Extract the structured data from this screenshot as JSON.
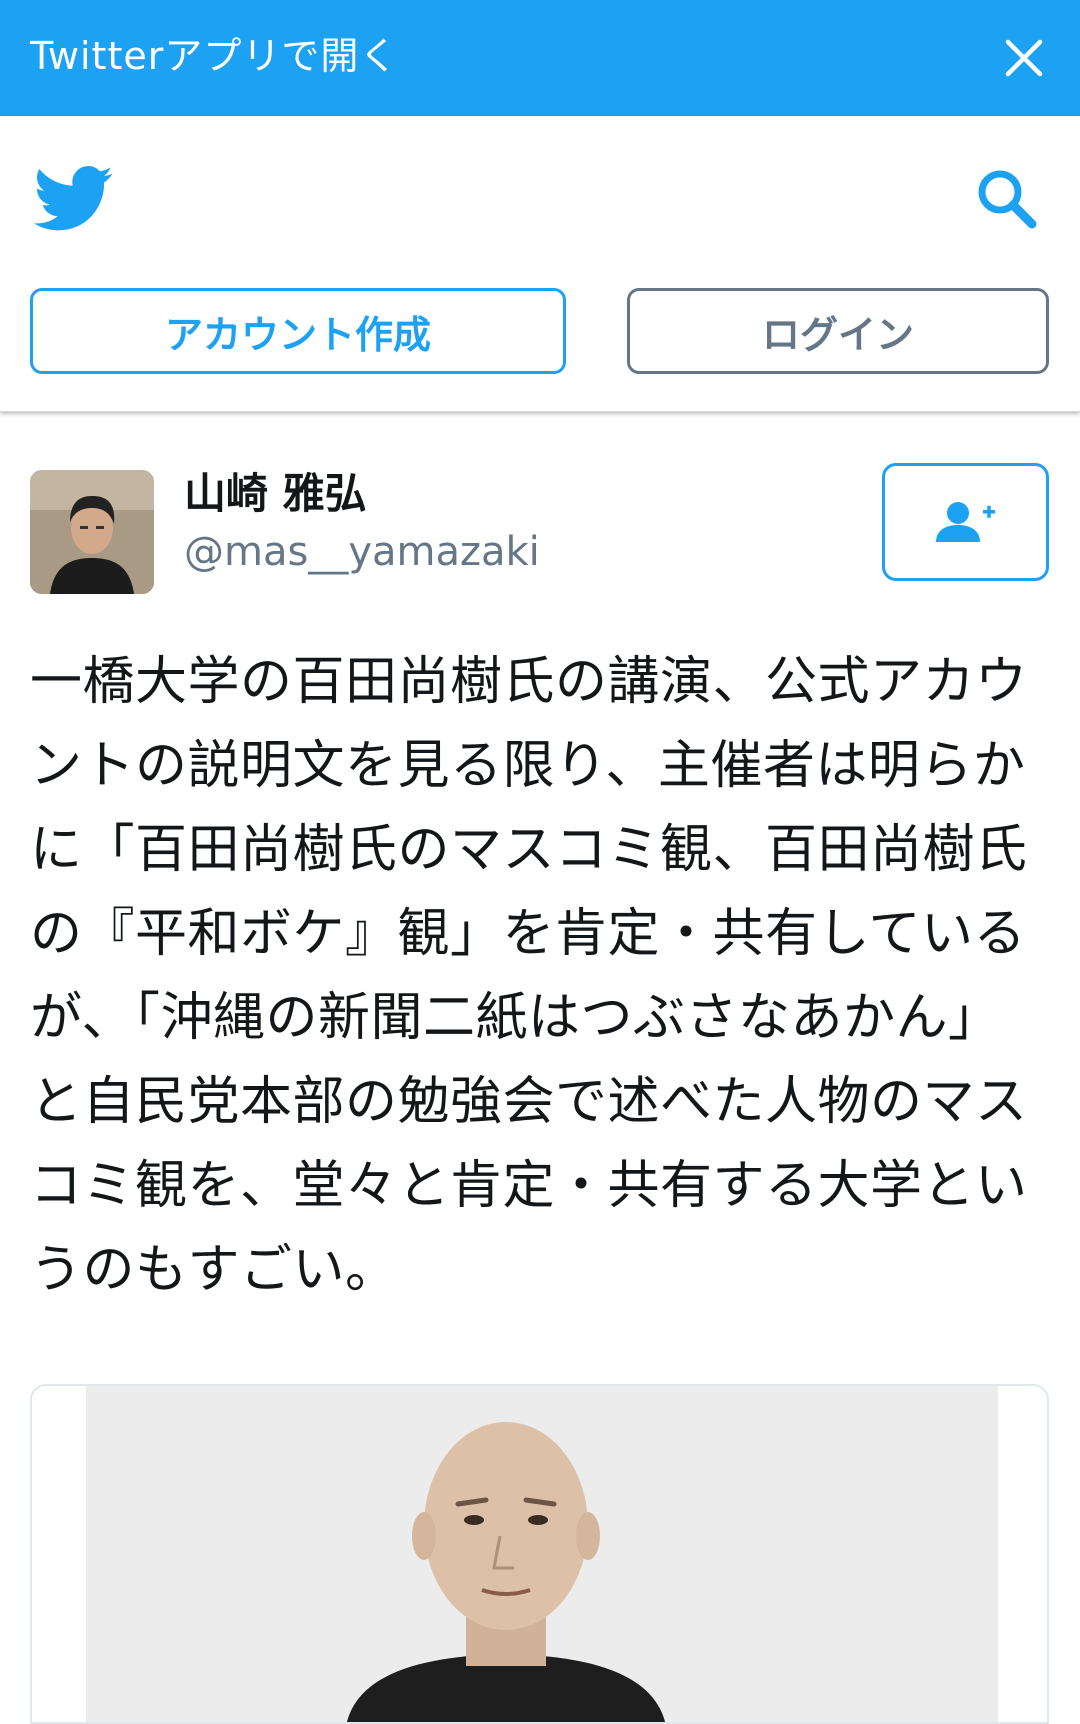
{
  "banner": {
    "text": "Twitterアプリで開く",
    "close_icon": "close-icon"
  },
  "header": {
    "logo_icon": "twitter-bird-icon",
    "search_icon": "search-icon",
    "signup_label": "アカウント作成",
    "login_label": "ログイン"
  },
  "tweet": {
    "user_name": "山崎 雅弘",
    "user_handle": "@mas__yamazaki",
    "follow_icon": "follow-user-icon",
    "text": "一橋大学の百田尚樹氏の講演、公式アカウントの説明文を見る限り、主催者は明らかに「百田尚樹氏のマスコミ観、百田尚樹氏の『平和ボケ』観」を肯定・共有しているが、「沖縄の新聞二紙はつぶさなあかん」と自民党本部の勉強会で述べた人物のマスコミ観を、堂々と肯定・共有する大学というのもすごい。"
  },
  "colors": {
    "brand": "#1da1f2",
    "muted": "#657786",
    "text": "#14171a"
  }
}
